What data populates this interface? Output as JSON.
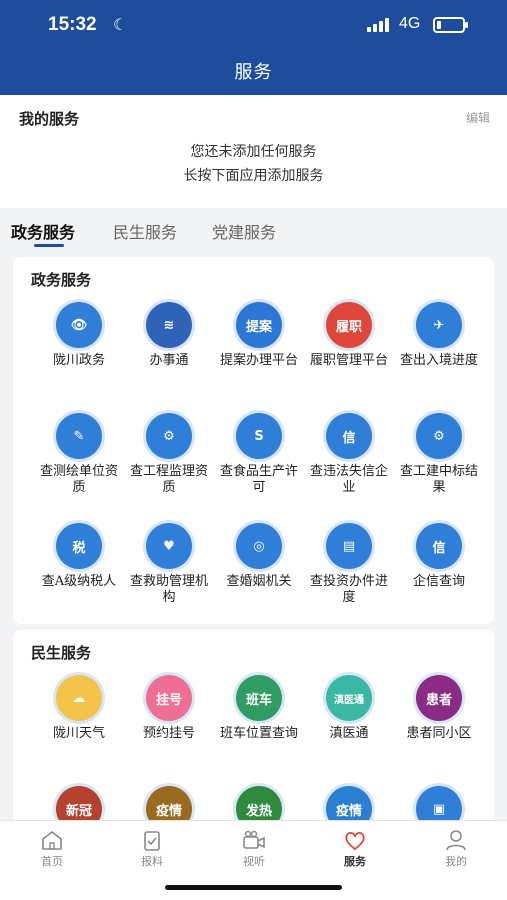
{
  "status": {
    "time": "15:32",
    "network": "4G"
  },
  "header": {
    "title": "服务"
  },
  "my_services": {
    "title": "我的服务",
    "edit": "编辑",
    "empty_line1": "您还未添加任何服务",
    "empty_line2": "长按下面应用添加服务"
  },
  "tabs": [
    "政务服务",
    "民生服务",
    "党建服务"
  ],
  "gov": {
    "title": "政务服务",
    "items": [
      {
        "label": "陇川政务",
        "icon": "eye-icon",
        "glyph": "👁",
        "color": "#2f7fd8"
      },
      {
        "label": "办事通",
        "icon": "chevron-logo-icon",
        "glyph": "≋",
        "color": "#2f63b8"
      },
      {
        "label": "提案办理平台",
        "icon": "proposal-icon",
        "glyph": "提案",
        "color": "#2c76d6"
      },
      {
        "label": "履职管理平台",
        "icon": "duty-icon",
        "glyph": "履职",
        "color": "#e0473b"
      },
      {
        "label": "查出入境进度",
        "icon": "airplane-icon",
        "glyph": "✈",
        "color": "#2f7fd8"
      },
      {
        "label": "查测绘单位资质",
        "icon": "ruler-icon",
        "glyph": "✎",
        "color": "#2f7fd8"
      },
      {
        "label": "查工程监理资质",
        "icon": "gear-icon",
        "glyph": "⚙",
        "color": "#2f7fd8"
      },
      {
        "label": "查食品生产许可",
        "icon": "food-license-icon",
        "glyph": "S",
        "color": "#2f7fd8"
      },
      {
        "label": "查违法失信企业",
        "icon": "credit-shield-icon",
        "glyph": "信",
        "color": "#2f7fd8"
      },
      {
        "label": "查工建中标结果",
        "icon": "construction-gear-icon",
        "glyph": "⚙",
        "color": "#2f7fd8"
      },
      {
        "label": "查A级纳税人",
        "icon": "tax-icon",
        "glyph": "税",
        "color": "#2f7fd8"
      },
      {
        "label": "查救助管理机构",
        "icon": "heart-hands-icon",
        "glyph": "♥",
        "color": "#2f7fd8"
      },
      {
        "label": "查婚姻机关",
        "icon": "rings-icon",
        "glyph": "◎",
        "color": "#2f7fd8"
      },
      {
        "label": "查投资办件进度",
        "icon": "investment-chart-icon",
        "glyph": "▤",
        "color": "#2f7fd8"
      },
      {
        "label": "企信查询",
        "icon": "enterprise-credit-icon",
        "glyph": "信",
        "color": "#2f7fd8"
      }
    ]
  },
  "life": {
    "title": "民生服务",
    "items": [
      {
        "label": "陇川天气",
        "icon": "weather-cloud-icon",
        "glyph": "☁",
        "color": "#f3c34a"
      },
      {
        "label": "预约挂号",
        "icon": "registration-icon",
        "glyph": "挂号",
        "color": "#ee6f93"
      },
      {
        "label": "班车位置查询",
        "icon": "shuttle-bus-icon",
        "glyph": "班车",
        "color": "#2f9c63"
      },
      {
        "label": "滇医通",
        "icon": "dian-yi-tong-icon",
        "glyph": "滇医通",
        "color": "#3bb8a4"
      },
      {
        "label": "患者同小区",
        "icon": "patient-community-icon",
        "glyph": "患者",
        "color": "#8b2b86"
      },
      {
        "label": "",
        "icon": "covid-notice-icon",
        "glyph": "新冠",
        "color": "#b5412f"
      },
      {
        "label": "",
        "icon": "epidemic-knowledge-icon",
        "glyph": "疫情",
        "color": "#9a6a1e"
      },
      {
        "label": "",
        "icon": "fever-clinic-icon",
        "glyph": "发热",
        "color": "#2f8a3e"
      },
      {
        "label": "",
        "icon": "epidemic-map-icon",
        "glyph": "疫情",
        "color": "#2b7fd0"
      },
      {
        "label": "",
        "icon": "document-icon",
        "glyph": "▣",
        "color": "#2f7fd8"
      }
    ]
  },
  "nav": [
    {
      "label": "首页",
      "icon": "home-icon"
    },
    {
      "label": "报料",
      "icon": "clipboard-icon"
    },
    {
      "label": "视听",
      "icon": "video-camera-icon"
    },
    {
      "label": "服务",
      "icon": "heart-icon"
    },
    {
      "label": "我的",
      "icon": "user-icon"
    }
  ]
}
